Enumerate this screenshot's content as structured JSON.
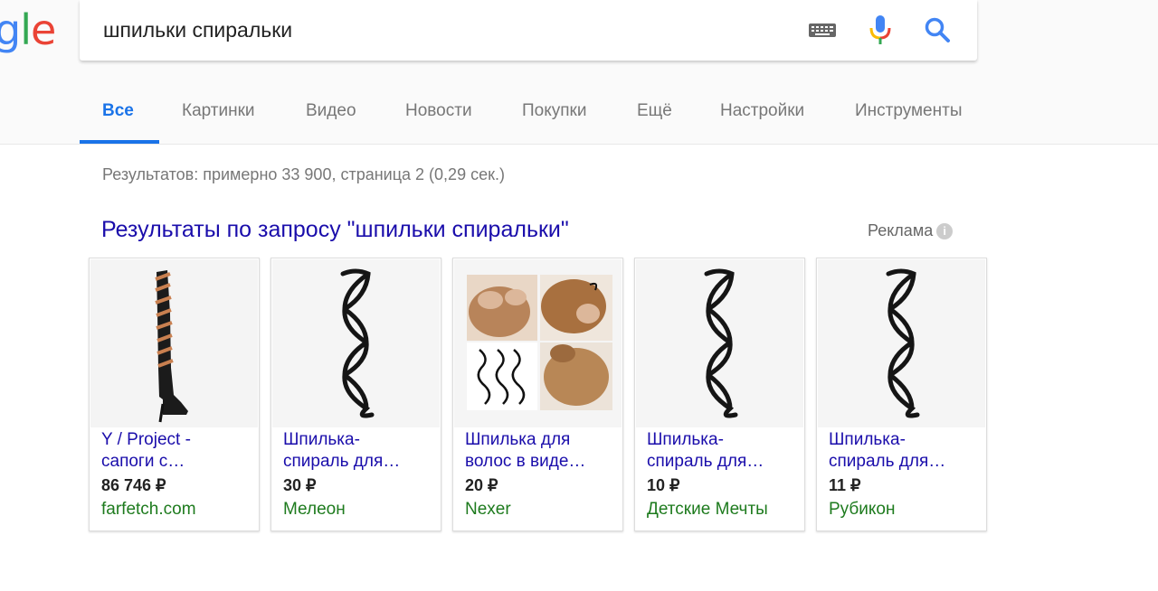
{
  "logo": {
    "g": "g",
    "l": "l",
    "e": "e"
  },
  "search": {
    "query": "шпильки спиральки"
  },
  "icons": [
    "keyboard-icon",
    "microphone-icon",
    "search-icon",
    "info-icon"
  ],
  "tabs": [
    {
      "label": "Все",
      "active": true
    },
    {
      "label": "Картинки"
    },
    {
      "label": "Видео"
    },
    {
      "label": "Новости"
    },
    {
      "label": "Покупки"
    },
    {
      "label": "Ещё"
    },
    {
      "label": "Настройки"
    },
    {
      "label": "Инструменты"
    }
  ],
  "result_stats": "Результатов: примерно 33 900, страница 2 (0,29 сек.)",
  "shopping": {
    "heading": "Результаты по запросу \"шпильки спиральки\"",
    "ad_label": "Реклама",
    "info_glyph": "i",
    "products": [
      {
        "title_line1": "Y / Project -",
        "title_line2": "сапоги с…",
        "price": "86 746 ₽",
        "merchant": "farfetch.com"
      },
      {
        "title_line1": "Шпилька-",
        "title_line2": "спираль для…",
        "price": "30 ₽",
        "merchant": "Мелеон"
      },
      {
        "title_line1": "Шпилька для",
        "title_line2": "волос в виде…",
        "price": "20 ₽",
        "merchant": "Nexer"
      },
      {
        "title_line1": "Шпилька-",
        "title_line2": "спираль для…",
        "price": "10 ₽",
        "merchant": "Детские Мечты"
      },
      {
        "title_line1": "Шпилька-",
        "title_line2": "спираль для…",
        "price": "11 ₽",
        "merchant": "Рубикон"
      }
    ]
  },
  "colors": {
    "link": "#1a0dab",
    "accent": "#1a73e8",
    "merchant": "#1e7b1e"
  }
}
